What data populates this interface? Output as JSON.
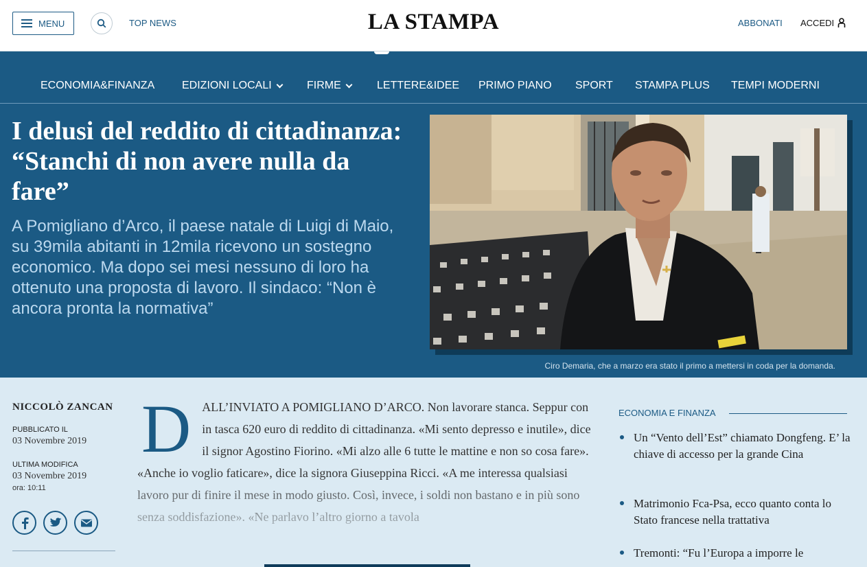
{
  "header": {
    "menu_label": "MENU",
    "top_news_label": "TOP NEWS",
    "logo_text": "LA STAMPA",
    "subscribe_label": "ABBONATI",
    "login_label": "ACCEDI"
  },
  "nav": {
    "items": [
      {
        "label": "ECONOMIA&FINANZA",
        "has_dropdown": false
      },
      {
        "label": "EDIZIONI LOCALI",
        "has_dropdown": true
      },
      {
        "label": "FIRME",
        "has_dropdown": true
      },
      {
        "label": "LETTERE&IDEE",
        "has_dropdown": false
      },
      {
        "label": "PRIMO PIANO",
        "has_dropdown": false
      },
      {
        "label": "SPORT",
        "has_dropdown": false
      },
      {
        "label": "STAMPA PLUS",
        "has_dropdown": false
      },
      {
        "label": "TEMPI MODERNI",
        "has_dropdown": false
      }
    ]
  },
  "article": {
    "headline": "I delusi del reddito di cittadinanza: “Stanchi di non avere nulla da fare”",
    "summary": "A Pomigliano d’Arco, il paese natale di Luigi di Maio, su 39mila abitanti in 12mila ricevono un sostegno economico. Ma dopo sei mesi nessuno di loro ha ottenuto una proposta di lavoro. Il sindaco: “Non è ancora pronta la normativa”",
    "photo_caption": "Ciro Demaria, che a marzo era stato il primo a mettersi in coda per la domanda.",
    "author": "NICCOLÒ ZANCAN",
    "published_label": "PUBBLICATO IL",
    "published_date": "03 Novembre 2019",
    "modified_label": "ULTIMA MODIFICA",
    "modified_date": "03 Novembre 2019",
    "modified_time": "ora: 10:11",
    "dropcap": "D",
    "body": "ALL’INVIATO A POMIGLIANO D’ARCO. Non lavorare stanca. Seppur con in tasca 620 euro di reddito di cittadinanza. «Mi sento depresso e inutile», dice il signor Agostino Fiorino. «Mi alzo alle 6 tutte le mattine e non so cosa fare». «Anche io voglio faticare», dice la signora Giuseppina Ricci. «A me interessa qualsiasi lavoro pur di finire il mese in modo giusto. Così, invece, i soldi non bastano e in più sono senza soddisfazione». «Ne parlavo l’altro giorno a tavola"
  },
  "share_icons": [
    "facebook-icon",
    "twitter-icon",
    "mail-icon"
  ],
  "sidebar": {
    "section_title": "ECONOMIA E FINANZA",
    "related": [
      "Un “Vento dell’Est” chiamato Dongfeng. E’ la chiave di accesso per la grande Cina",
      "Matrimonio Fca-Psa, ecco quanto conta lo Stato francese nella trattativa",
      "Tremonti: “Fu l’Europa a imporre le"
    ]
  },
  "colors": {
    "brand_blue": "#1b5a84",
    "page_bg": "#dbeaf3",
    "summary_text": "#bcd9ef"
  }
}
